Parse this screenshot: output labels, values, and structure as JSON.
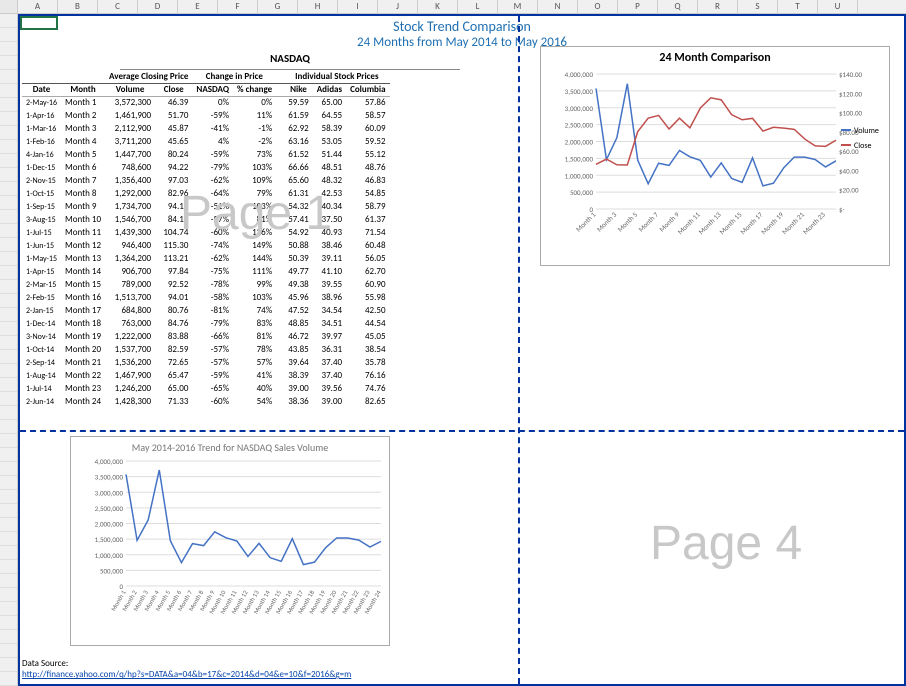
{
  "columns": [
    "",
    "A",
    "B",
    "C",
    "D",
    "E",
    "F",
    "G",
    "H",
    "I",
    "J",
    "K",
    "L",
    "M",
    "N",
    "O",
    "P",
    "Q",
    "R",
    "S",
    "T",
    "U"
  ],
  "title1": "Stock Trend Comparison",
  "title2": "24 Months from May 2014 to May 2016",
  "nasdaq": "NASDAQ",
  "group_headers": {
    "avg": "Average Closing Price",
    "chg": "Change in Price",
    "ind": "Individual Stock Prices"
  },
  "headers": {
    "date": "Date",
    "month": "Month",
    "volume": "Volume",
    "close": "Close",
    "nasdaq": "NASDAQ",
    "pct": "% change",
    "nike": "Nike",
    "adidas": "Adidas",
    "columbia": "Columbia"
  },
  "rows": [
    {
      "date": "2-May-16",
      "month": "Month 1",
      "volume": "3,572,300",
      "close": "46.39",
      "nas": "0%",
      "pct": "0%",
      "nike": "59.59",
      "adi": "65.00",
      "col": "57.86"
    },
    {
      "date": "1-Apr-16",
      "month": "Month 2",
      "volume": "1,461,900",
      "close": "51.70",
      "nas": "-59%",
      "pct": "11%",
      "nike": "61.59",
      "adi": "64.55",
      "col": "58.57"
    },
    {
      "date": "1-Mar-16",
      "month": "Month 3",
      "volume": "2,112,900",
      "close": "45.87",
      "nas": "-41%",
      "pct": "-1%",
      "nike": "62.92",
      "adi": "58.39",
      "col": "60.09"
    },
    {
      "date": "1-Feb-16",
      "month": "Month 4",
      "volume": "3,711,200",
      "close": "45.65",
      "nas": "4%",
      "pct": "-2%",
      "nike": "63.16",
      "adi": "53.05",
      "col": "59.52"
    },
    {
      "date": "4-Jan-16",
      "month": "Month 5",
      "volume": "1,447,700",
      "close": "80.24",
      "nas": "-59%",
      "pct": "73%",
      "nike": "61.52",
      "adi": "51.44",
      "col": "55.12"
    },
    {
      "date": "1-Dec-15",
      "month": "Month 6",
      "volume": "748,600",
      "close": "94.22",
      "nas": "-79%",
      "pct": "103%",
      "nike": "66.66",
      "adi": "48.51",
      "col": "48.76"
    },
    {
      "date": "2-Nov-15",
      "month": "Month 7",
      "volume": "1,356,400",
      "close": "97.03",
      "nas": "-62%",
      "pct": "109%",
      "nike": "65.60",
      "adi": "48.32",
      "col": "46.83"
    },
    {
      "date": "1-Oct-15",
      "month": "Month 8",
      "volume": "1,292,000",
      "close": "82.96",
      "nas": "-64%",
      "pct": "79%",
      "nike": "61.31",
      "adi": "42.53",
      "col": "54.85"
    },
    {
      "date": "1-Sep-15",
      "month": "Month 9",
      "volume": "1,734,700",
      "close": "94.19",
      "nas": "-51%",
      "pct": "103%",
      "nike": "54.32",
      "adi": "40.34",
      "col": "58.79"
    },
    {
      "date": "3-Aug-15",
      "month": "Month 10",
      "volume": "1,546,700",
      "close": "84.17",
      "nas": "-57%",
      "pct": "81%",
      "nike": "57.41",
      "adi": "37.50",
      "col": "61.37"
    },
    {
      "date": "1-Jul-15",
      "month": "Month 11",
      "volume": "1,439,300",
      "close": "104.74",
      "nas": "-60%",
      "pct": "126%",
      "nike": "54.92",
      "adi": "40.93",
      "col": "71.54"
    },
    {
      "date": "1-Jun-15",
      "month": "Month 12",
      "volume": "946,400",
      "close": "115.30",
      "nas": "-74%",
      "pct": "149%",
      "nike": "50.88",
      "adi": "38.46",
      "col": "60.48"
    },
    {
      "date": "1-May-15",
      "month": "Month 13",
      "volume": "1,364,200",
      "close": "113.21",
      "nas": "-62%",
      "pct": "144%",
      "nike": "50.39",
      "adi": "39.11",
      "col": "56.05"
    },
    {
      "date": "1-Apr-15",
      "month": "Month 14",
      "volume": "906,700",
      "close": "97.84",
      "nas": "-75%",
      "pct": "111%",
      "nike": "49.77",
      "adi": "41.10",
      "col": "62.70"
    },
    {
      "date": "2-Mar-15",
      "month": "Month 15",
      "volume": "789,000",
      "close": "92.52",
      "nas": "-78%",
      "pct": "99%",
      "nike": "49.38",
      "adi": "39.55",
      "col": "60.90"
    },
    {
      "date": "2-Feb-15",
      "month": "Month 16",
      "volume": "1,513,700",
      "close": "94.01",
      "nas": "-58%",
      "pct": "103%",
      "nike": "45.96",
      "adi": "38.96",
      "col": "55.98"
    },
    {
      "date": "2-Jan-15",
      "month": "Month 17",
      "volume": "684,800",
      "close": "80.76",
      "nas": "-81%",
      "pct": "74%",
      "nike": "47.52",
      "adi": "34.54",
      "col": "42.50"
    },
    {
      "date": "1-Dec-14",
      "month": "Month 18",
      "volume": "763,000",
      "close": "84.76",
      "nas": "-79%",
      "pct": "83%",
      "nike": "48.85",
      "adi": "34.51",
      "col": "44.54"
    },
    {
      "date": "3-Nov-14",
      "month": "Month 19",
      "volume": "1,222,000",
      "close": "83.88",
      "nas": "-66%",
      "pct": "81%",
      "nike": "46.72",
      "adi": "39.97",
      "col": "45.05"
    },
    {
      "date": "1-Oct-14",
      "month": "Month 20",
      "volume": "1,537,700",
      "close": "82.59",
      "nas": "-57%",
      "pct": "78%",
      "nike": "43.85",
      "adi": "36.31",
      "col": "38.54"
    },
    {
      "date": "2-Sep-14",
      "month": "Month 21",
      "volume": "1,536,200",
      "close": "72.65",
      "nas": "-57%",
      "pct": "57%",
      "nike": "39.64",
      "adi": "37.40",
      "col": "35.78"
    },
    {
      "date": "1-Aug-14",
      "month": "Month 22",
      "volume": "1,467,900",
      "close": "65.47",
      "nas": "-59%",
      "pct": "41%",
      "nike": "38.39",
      "adi": "37.40",
      "col": "76.16"
    },
    {
      "date": "1-Jul-14",
      "month": "Month 23",
      "volume": "1,246,200",
      "close": "65.00",
      "nas": "-65%",
      "pct": "40%",
      "nike": "39.00",
      "adi": "39.56",
      "col": "74.76"
    },
    {
      "date": "2-Jun-14",
      "month": "Month 24",
      "volume": "1,428,300",
      "close": "71.33",
      "nas": "-60%",
      "pct": "54%",
      "nike": "38.36",
      "adi": "39.00",
      "col": "82.65"
    }
  ],
  "watermarks": {
    "p1": "Page 1",
    "p4": "Page 4"
  },
  "source_label": "Data Source:",
  "source_url_text": "http://finance.yahoo.com/q/hp?s=DATA&a=04&b=17&c=2014&d=04&e=10&f=2016&g=m",
  "chart_data": [
    {
      "type": "line",
      "title": "24 Month Comparison",
      "x_categories": [
        "Month 1",
        "Month 3",
        "Month 5",
        "Month 7",
        "Month 9",
        "Month 11",
        "Month 13",
        "Month 15",
        "Month 17",
        "Month 19",
        "Month 21",
        "Month 23"
      ],
      "y1_ticks": [
        0,
        500000,
        1000000,
        1500000,
        2000000,
        2500000,
        3000000,
        3500000,
        4000000
      ],
      "y2_ticks": [
        "$-",
        "$20.00",
        "$40.00",
        "$60.00",
        "$80.00",
        "$100.00",
        "$120.00",
        "$140.00"
      ],
      "series": [
        {
          "name": "Volume",
          "color": "#4472c4",
          "axis": "left",
          "values": [
            3572300,
            1461900,
            2112900,
            3711200,
            1447700,
            748600,
            1356400,
            1292000,
            1734700,
            1546700,
            1439300,
            946400,
            1364200,
            906700,
            789000,
            1513700,
            684800,
            763000,
            1222000,
            1537700,
            1536200,
            1467900,
            1246200,
            1428300
          ]
        },
        {
          "name": "Close",
          "color": "#c0504d",
          "axis": "right",
          "values": [
            46.39,
            51.7,
            45.87,
            45.65,
            80.24,
            94.22,
            97.03,
            82.96,
            94.19,
            84.17,
            104.74,
            115.3,
            113.21,
            97.84,
            92.52,
            94.01,
            80.76,
            84.76,
            83.88,
            82.59,
            72.65,
            65.47,
            65.0,
            71.33
          ]
        }
      ]
    },
    {
      "type": "line",
      "title": "May 2014-2016 Trend for NASDAQ Sales Volume",
      "x_categories": [
        "Month 1",
        "Month 2",
        "Month 3",
        "Month 4",
        "Month 5",
        "Month 6",
        "Month 7",
        "Month 8",
        "Month 9",
        "Month 10",
        "Month 11",
        "Month 12",
        "Month 13",
        "Month 14",
        "Month 15",
        "Month 16",
        "Month 17",
        "Month 18",
        "Month 19",
        "Month 20",
        "Month 21",
        "Month 22",
        "Month 23",
        "Month 24"
      ],
      "y_ticks": [
        0,
        500000,
        1000000,
        1500000,
        2000000,
        2500000,
        3000000,
        3500000,
        4000000
      ],
      "series": [
        {
          "name": "Volume",
          "color": "#4472c4",
          "values": [
            3572300,
            1461900,
            2112900,
            3711200,
            1447700,
            748600,
            1356400,
            1292000,
            1734700,
            1546700,
            1439300,
            946400,
            1364200,
            906700,
            789000,
            1513700,
            684800,
            763000,
            1222000,
            1537700,
            1536200,
            1467900,
            1246200,
            1428300
          ]
        }
      ]
    }
  ]
}
